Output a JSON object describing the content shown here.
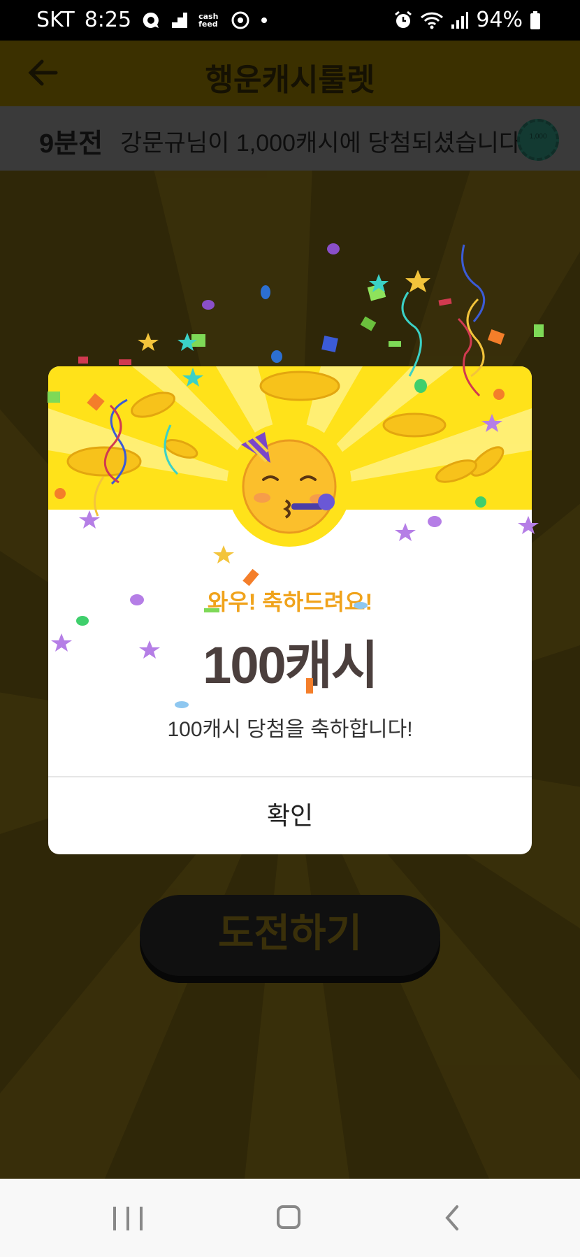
{
  "status_bar": {
    "carrier": "SKT",
    "time": "8:25",
    "cashfeed_badge": "cash feed",
    "battery": "94%",
    "icons": [
      "chat-bubble-icon",
      "stairs-icon",
      "cashfeed-icon",
      "target-icon",
      "dot-icon",
      "alarm-icon",
      "wifi-icon",
      "signal-icon",
      "battery-icon"
    ]
  },
  "app_bar": {
    "title": "행운캐시룰렛",
    "back_icon": "arrow-left-icon"
  },
  "ticker": {
    "time_ago": "9분전",
    "message": "강문규님이 1,000캐시에 당첨되셨습니다.",
    "chip_label": "1,000"
  },
  "challenge_button": {
    "label": "도전하기"
  },
  "dialog": {
    "headline": "와우! 축하드려요!",
    "amount": "100캐시",
    "description": "100캐시 당첨을 축하합니다!",
    "confirm_label": "확인",
    "emoji": "partying-face-icon"
  },
  "nav_bar": {
    "icons": [
      "recents-icon",
      "home-icon",
      "back-icon"
    ]
  },
  "colors": {
    "dialog_banner": "#ffe21a",
    "headline": "#f0a31c",
    "amount": "#4b3f3d",
    "backdrop": "#2f2708"
  }
}
